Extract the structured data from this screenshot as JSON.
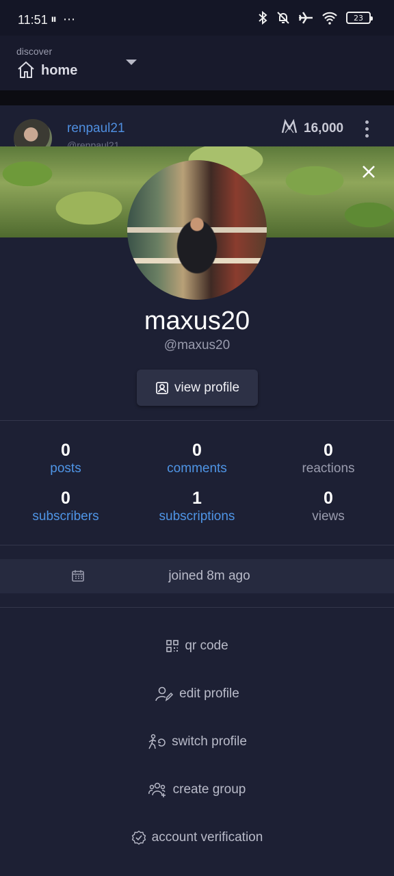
{
  "status_bar": {
    "time": "11:51",
    "left_icons": "⏸ ⋯",
    "battery": "23"
  },
  "header": {
    "section_label": "discover",
    "feed_label": "home"
  },
  "post": {
    "username": "renpaul21",
    "sub": "@renpaul21",
    "points": "16,000"
  },
  "profile": {
    "display_name": "maxus20",
    "handle": "@maxus20",
    "view_profile_label": "view profile"
  },
  "stats": [
    {
      "value": "0",
      "label": "posts"
    },
    {
      "value": "0",
      "label": "comments"
    },
    {
      "value": "0",
      "label": "reactions"
    },
    {
      "value": "0",
      "label": "subscribers"
    },
    {
      "value": "1",
      "label": "subscriptions"
    },
    {
      "value": "0",
      "label": "views"
    }
  ],
  "joined": "joined 8m ago",
  "menu": {
    "qr_code": "qr code",
    "edit_profile": "edit profile",
    "switch_profile": "switch profile",
    "create_group": "create group",
    "account_verification": "account verification"
  },
  "colors": {
    "background": "#1d2034",
    "link_blue": "#4f95e6",
    "muted": "#9a9cae"
  }
}
